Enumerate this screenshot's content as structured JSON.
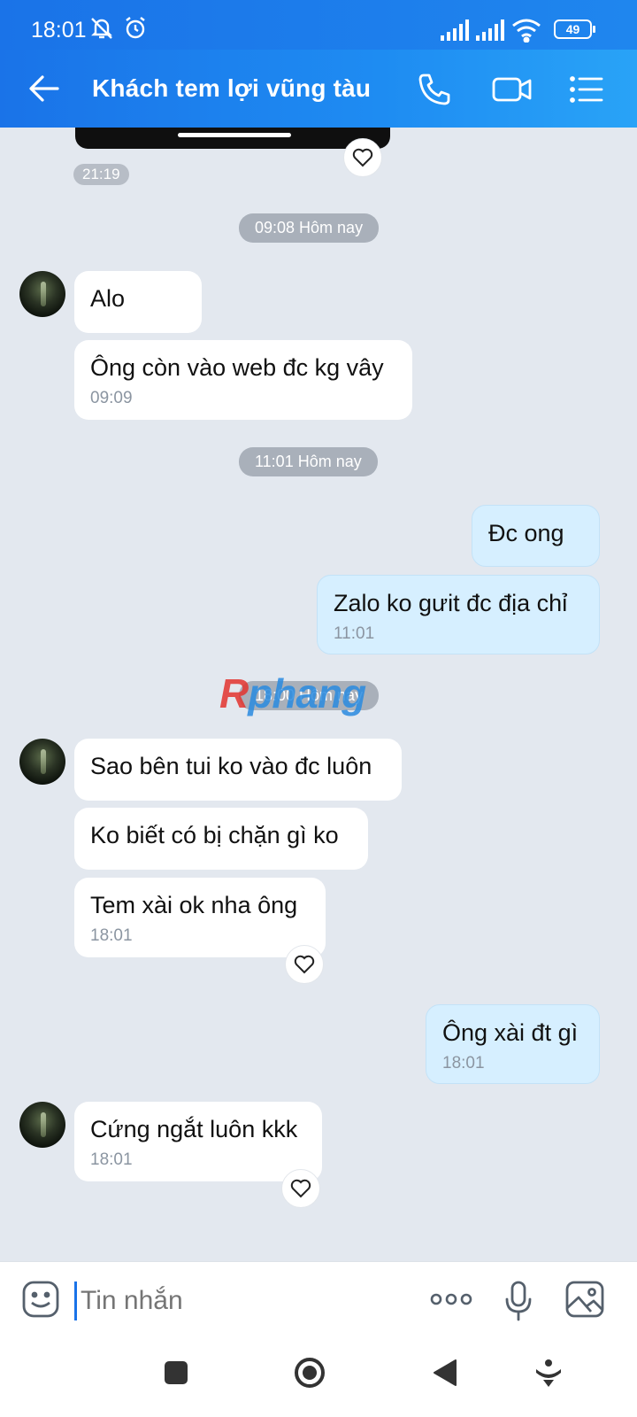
{
  "status_bar": {
    "time": "18:01",
    "battery": "49"
  },
  "header": {
    "title": "Khách tem lợi vũng tàu"
  },
  "chat": {
    "top_time": "21:19",
    "separators": [
      "09:08 Hôm nay",
      "11:01 Hôm nay",
      "18:00 Hôm nay"
    ],
    "messages": [
      {
        "text": "Alo"
      },
      {
        "text": "Ông còn vào web đc kg vây",
        "time": "09:09"
      },
      {
        "text": "Đc ong"
      },
      {
        "text": "Zalo ko gưit đc địa chỉ",
        "time": "11:01"
      },
      {
        "text": "Sao bên tui ko vào đc luôn"
      },
      {
        "text": "Ko biết có bị chặn gì ko"
      },
      {
        "text": "Tem xài ok nha ông",
        "time": "18:01"
      },
      {
        "text": "Ông xài đt gì",
        "time": "18:01"
      },
      {
        "text": "Cứng ngắt luôn kkk",
        "time": "18:01"
      }
    ],
    "watermark": {
      "part1": "R",
      "part2": "phang"
    }
  },
  "composer": {
    "placeholder": "Tin nhắn"
  },
  "icons": [
    "back-arrow-icon",
    "phone-icon",
    "video-call-icon",
    "menu-list-icon",
    "heart-icon",
    "emoji-icon",
    "more-dots-icon",
    "microphone-icon",
    "image-icon"
  ]
}
